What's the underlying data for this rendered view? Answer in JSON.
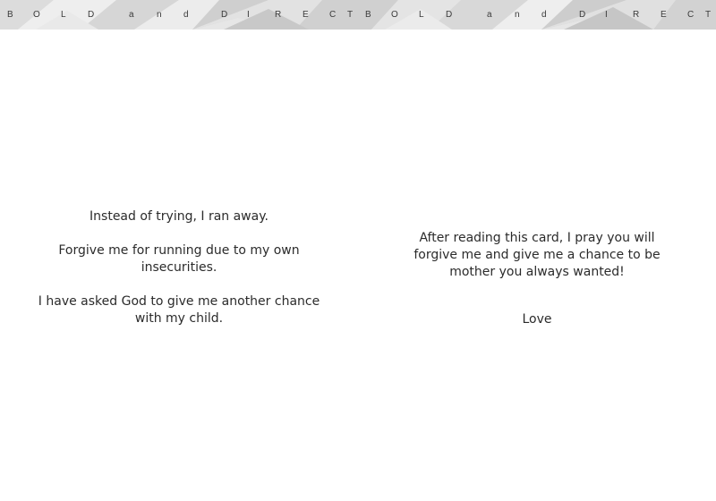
{
  "banner": {
    "letters": [
      "B",
      "O",
      "L",
      "D",
      "a",
      "n",
      "d",
      "D",
      "I",
      "R",
      "E",
      "C",
      "T"
    ],
    "colors": {
      "base": "#e6e6e6",
      "light": "#f0f0f0",
      "mid": "#d4d4d4",
      "dark": "#c6c6c6",
      "text": "#3a3a3a"
    }
  },
  "left_page": {
    "paragraphs": [
      [
        "Instead of trying, I ran away."
      ],
      [
        "Forgive me for running due to my own",
        "insecurities."
      ],
      [
        "I have asked God to give me another chance",
        "with my child."
      ]
    ]
  },
  "right_page": {
    "paragraphs": [
      [
        "After reading this card, I pray you will",
        "forgive me and give me a chance to be",
        "mother you always wanted!"
      ],
      [
        "Love"
      ]
    ]
  }
}
